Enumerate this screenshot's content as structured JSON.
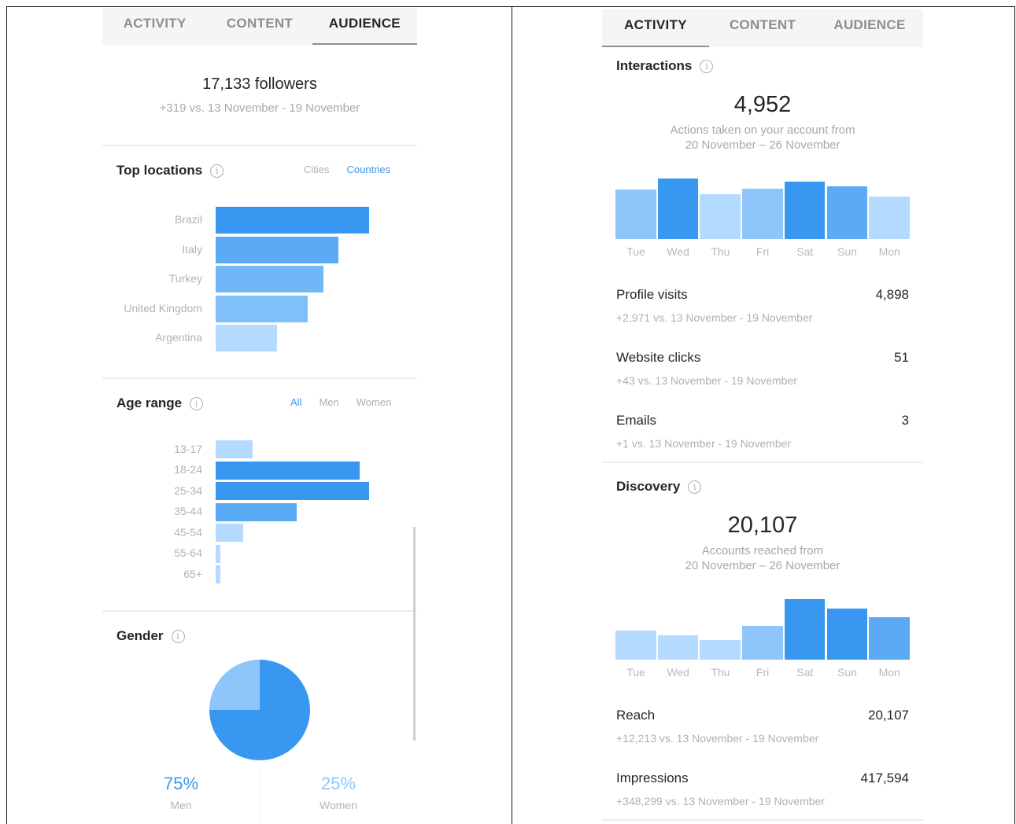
{
  "left": {
    "tabs": [
      "ACTIVITY",
      "CONTENT",
      "AUDIENCE"
    ],
    "followers": "17,133 followers",
    "followers_change": "+319 vs. 13 November - 19 November",
    "top_locations": {
      "title": "Top locations",
      "filters": [
        "Cities",
        "Countries"
      ],
      "active_filter": "Countries",
      "items": [
        {
          "label": "Brazil",
          "value": 100,
          "color": "#3897f0"
        },
        {
          "label": "Italy",
          "value": 80,
          "color": "#5aaaf5"
        },
        {
          "label": "Turkey",
          "value": 70,
          "color": "#6fb7f7"
        },
        {
          "label": "United Kingdom",
          "value": 60,
          "color": "#80c0f8"
        },
        {
          "label": "Argentina",
          "value": 40,
          "color": "#b5daff"
        }
      ]
    },
    "age_range": {
      "title": "Age range",
      "filters": [
        "All",
        "Men",
        "Women"
      ],
      "active_filter": "All",
      "items": [
        {
          "label": "13-17",
          "value": 24,
          "color": "#b5daff"
        },
        {
          "label": "18-24",
          "value": 94,
          "color": "#3897f0"
        },
        {
          "label": "25-34",
          "value": 100,
          "color": "#3897f0"
        },
        {
          "label": "35-44",
          "value": 53,
          "color": "#5aaaf5"
        },
        {
          "label": "45-54",
          "value": 18,
          "color": "#b5daff"
        },
        {
          "label": "55-64",
          "value": 3,
          "color": "#b5daff"
        },
        {
          "label": "65+",
          "value": 3,
          "color": "#b5daff"
        }
      ]
    },
    "gender": {
      "title": "Gender",
      "men_pct": "75%",
      "men_label": "Men",
      "women_pct": "25%",
      "women_label": "Women",
      "men_value": 75,
      "women_value": 25,
      "men_color": "#3897f0",
      "women_color": "#8ec5fa"
    }
  },
  "right": {
    "tabs": [
      "ACTIVITY",
      "CONTENT",
      "AUDIENCE"
    ],
    "interactions": {
      "title": "Interactions",
      "total": "4,952",
      "sub1": "Actions taken on your account from",
      "sub2": "20 November – 26 November",
      "days": [
        "Tue",
        "Wed",
        "Thu",
        "Fri",
        "Sat",
        "Sun",
        "Mon"
      ],
      "values": [
        63,
        77,
        57,
        64,
        73,
        67,
        54
      ],
      "colors": [
        "#8ec5fa",
        "#3897f0",
        "#b5daff",
        "#8ec5fa",
        "#3897f0",
        "#5aaaf5",
        "#b5daff"
      ]
    },
    "metrics1": [
      {
        "name": "Profile visits",
        "value": "4,898",
        "sub": "+2,971 vs. 13 November - 19 November"
      },
      {
        "name": "Website clicks",
        "value": "51",
        "sub": "+43 vs. 13 November - 19 November"
      },
      {
        "name": "Emails",
        "value": "3",
        "sub": "+1 vs. 13 November - 19 November"
      }
    ],
    "discovery": {
      "title": "Discovery",
      "total": "20,107",
      "sub1": "Accounts reached from",
      "sub2": "20 November – 26 November",
      "days": [
        "Tue",
        "Wed",
        "Thu",
        "Fri",
        "Sat",
        "Sun",
        "Mon"
      ],
      "values": [
        37,
        31,
        25,
        43,
        77,
        65,
        54
      ],
      "colors": [
        "#b5daff",
        "#b5daff",
        "#b5daff",
        "#8ec5fa",
        "#3897f0",
        "#3897f0",
        "#5aaaf5"
      ]
    },
    "metrics2": [
      {
        "name": "Reach",
        "value": "20,107",
        "sub": "+12,213 vs. 13 November - 19 November"
      },
      {
        "name": "Impressions",
        "value": "417,594",
        "sub": "+348,299 vs. 13 November - 19 November"
      }
    ]
  }
}
